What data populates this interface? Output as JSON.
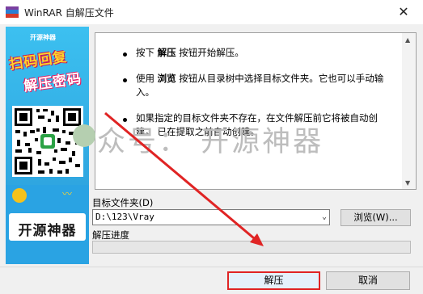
{
  "window": {
    "title": "WinRAR 自解压文件",
    "close_glyph": "✕"
  },
  "left_panel": {
    "small_text": "开源神器",
    "promo_line1": "扫码回复",
    "promo_line2": "解压密码",
    "brand": "开源神器"
  },
  "instructions": [
    {
      "pre": "按下 ",
      "bold": "解压",
      "post": " 按钮开始解压。"
    },
    {
      "pre": "使用 ",
      "bold": "浏览",
      "post": " 按钮从目录树中选择目标文件夹。它也可以手动输入。"
    },
    {
      "pre": "",
      "bold": "",
      "post": "如果指定的目标文件夹不存在，在文件解压前它将被自动创建。 已在提取之前自动创建。"
    }
  ],
  "watermark": "众号： 开源神器",
  "target_label": "目标文件夹(D)",
  "target_path": "D:\\123\\Vray",
  "browse_label": "浏览(W)...",
  "progress_label": "解压进度",
  "progress": 0,
  "ok_label": "解压",
  "cancel_label": "取消",
  "colors": {
    "highlight": "#e02424",
    "panel": "#39b3ea"
  }
}
